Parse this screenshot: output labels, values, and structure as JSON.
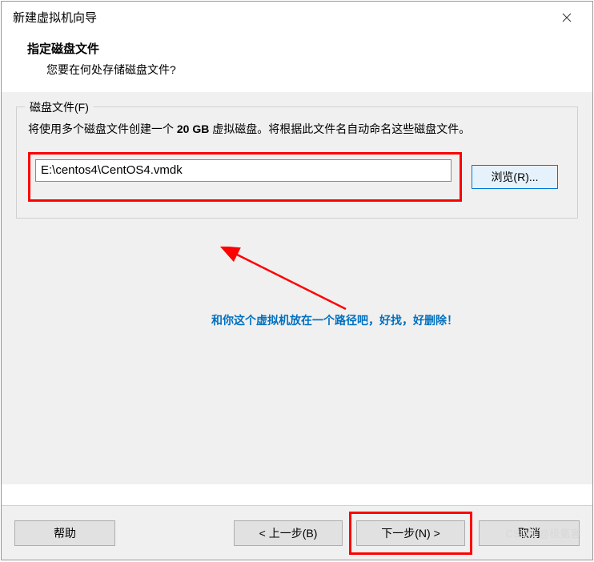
{
  "window": {
    "title": "新建虚拟机向导"
  },
  "header": {
    "title": "指定磁盘文件",
    "subtitle": "您要在何处存储磁盘文件?"
  },
  "group": {
    "label": "磁盘文件(F)",
    "description_pre": "将使用多个磁盘文件创建一个 ",
    "description_bold": "20 GB",
    "description_post": " 虚拟磁盘。将根据此文件名自动命名这些磁盘文件。",
    "file_path": "E:\\centos4\\CentOS4.vmdk",
    "browse_label": "浏览(R)..."
  },
  "annotation": {
    "text": "和你这个虚拟机放在一个路径吧，好找，好删除！"
  },
  "buttons": {
    "help": "帮助",
    "back": "< 上一步(B)",
    "next": "下一步(N) >",
    "cancel": "取消"
  },
  "watermark": "CSDN @极氪客"
}
